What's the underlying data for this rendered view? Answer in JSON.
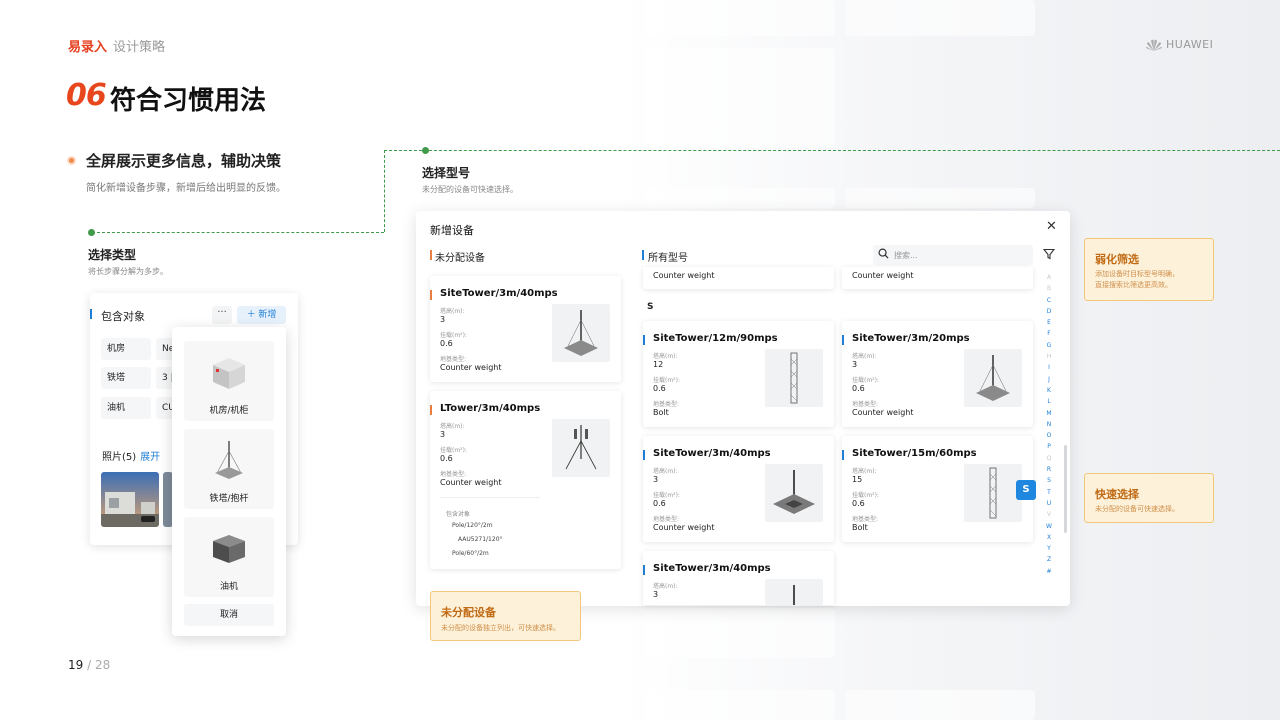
{
  "header": {
    "brand_main": "易录入",
    "brand_sub": "设计策略",
    "company": "HUAWEI",
    "section_num": "06",
    "section_title": "符合习惯用法"
  },
  "intro": {
    "title": "全屏展示更多信息，辅助决策",
    "desc": "简化新增设备步骤，新增后给出明显的反馈。"
  },
  "step_type": {
    "label": "选择类型",
    "desc": "将长步骤分解为多步。"
  },
  "step_model": {
    "label": "选择型号",
    "desc": "未分配的设备可快速选择。"
  },
  "left_panel": {
    "title": "包含对象",
    "more": "···",
    "add": "＋ 新增",
    "rows": [
      {
        "name": "机房",
        "value": "Ne"
      },
      {
        "name": "铁塔",
        "value": "3 |"
      },
      {
        "name": "油机",
        "value": "CU"
      }
    ],
    "photos_label": "照片(5)",
    "photos_expand": "展开"
  },
  "chooser": {
    "items": [
      "机房/机柜",
      "铁塔/抱杆",
      "油机"
    ],
    "cancel": "取消"
  },
  "dialog": {
    "title": "新增设备",
    "close": "✕",
    "col_unassigned": "未分配设备",
    "col_all": "所有型号",
    "search_placeholder": "搜索...",
    "group_letter": "S",
    "partial_label": "Counter weight",
    "unassigned_cards": [
      {
        "title": "SiteTower/3m/40mps",
        "h_label": "塔高(m):",
        "h_value": "3",
        "a_label": "挂载(m²):",
        "a_value": "0.6",
        "f_label": "地基类型:",
        "f_value": "Counter weight"
      },
      {
        "title": "LTower/3m/40mps",
        "h_label": "塔高(m):",
        "h_value": "3",
        "a_label": "挂载(m²):",
        "a_value": "0.6",
        "f_label": "地基类型:",
        "f_value": "Counter weight",
        "tree_title": "包含对象",
        "tree": [
          "Pole/120°/2m",
          "AAU5271/120°",
          "Pole/60°/2m"
        ]
      }
    ],
    "model_cards": [
      {
        "title": "SiteTower/12m/90mps",
        "h_label": "塔高(m):",
        "h_value": "12",
        "a_label": "挂载(m²):",
        "a_value": "0.6",
        "f_label": "地基类型:",
        "f_value": "Bolt"
      },
      {
        "title": "SiteTower/3m/20mps",
        "h_label": "塔高(m):",
        "h_value": "3",
        "a_label": "挂载(m²):",
        "a_value": "0.6",
        "f_label": "地基类型:",
        "f_value": "Counter weight"
      },
      {
        "title": "SiteTower/3m/40mps",
        "h_label": "塔高(m):",
        "h_value": "3",
        "a_label": "挂载(m²):",
        "a_value": "0.6",
        "f_label": "地基类型:",
        "f_value": "Counter weight"
      },
      {
        "title": "SiteTower/15m/60mps",
        "h_label": "塔高(m):",
        "h_value": "15",
        "a_label": "挂载(m²):",
        "a_value": "0.6",
        "f_label": "地基类型:",
        "f_value": "Bolt"
      },
      {
        "title": "SiteTower/3m/40mps",
        "h_label": "塔高(m):",
        "h_value": "3"
      }
    ],
    "alphabet": [
      "A",
      "B",
      "C",
      "D",
      "E",
      "F",
      "G",
      "H",
      "I",
      "J",
      "K",
      "L",
      "M",
      "N",
      "O",
      "P",
      "Q",
      "R",
      "S",
      "T",
      "U",
      "V",
      "W",
      "X",
      "Y",
      "Z",
      "#"
    ],
    "alphabet_dim": [
      "A",
      "B",
      "H",
      "Q",
      "V"
    ],
    "active_letter": "S"
  },
  "callouts": {
    "weak_filter": {
      "title": "弱化筛选",
      "desc1": "添加设备时目标型号明确，",
      "desc2": "直接搜索比筛选更高效。"
    },
    "quick_select": {
      "title": "快速选择",
      "desc": "未分配的设备可快速选择。"
    },
    "unassigned": {
      "title": "未分配设备",
      "desc": "未分配的设备独立列出，可快速选择。"
    }
  },
  "pagination": {
    "current": "19",
    "sep": " / ",
    "total": "28"
  },
  "colors": {
    "accent": "#e8471d",
    "link": "#1f7fd6",
    "guide": "#3f9a4a",
    "callout_bg": "#fdf1da"
  }
}
